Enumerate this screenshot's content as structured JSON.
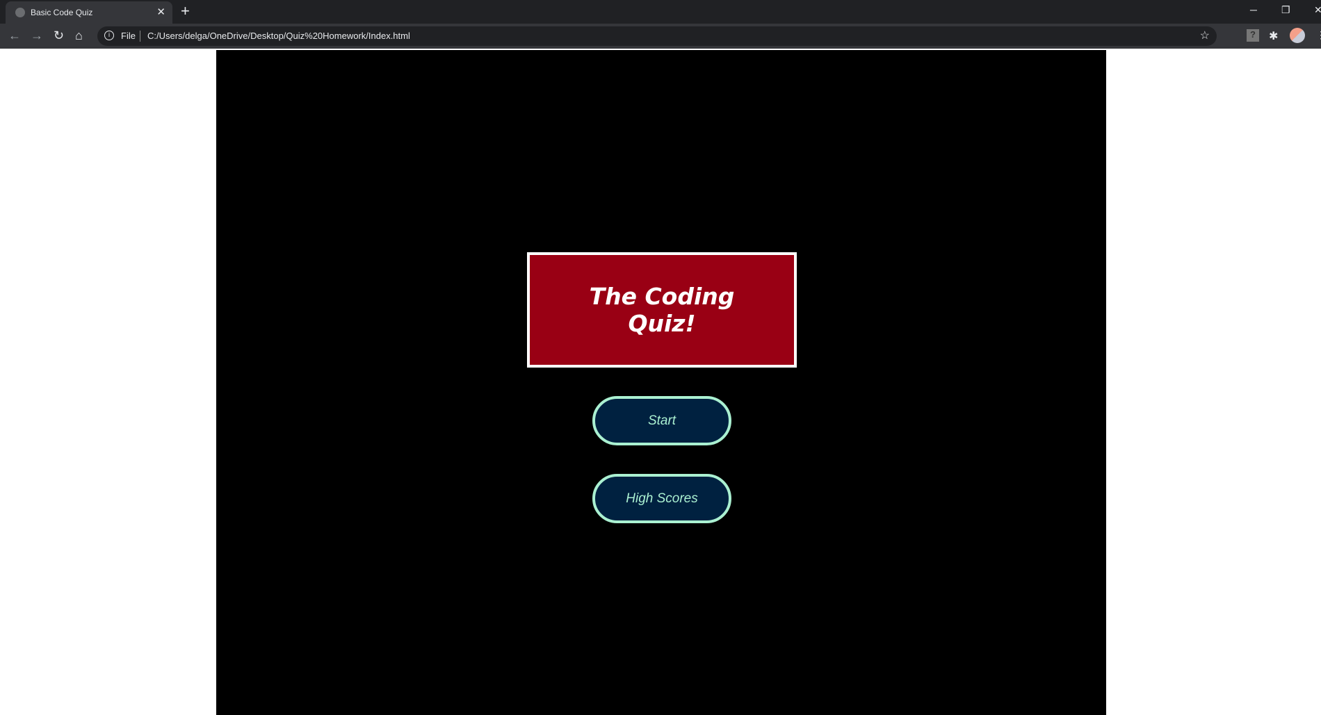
{
  "browser": {
    "tab_title": "Basic Code Quiz",
    "new_tab": "+",
    "scheme_label": "File",
    "url": "C:/Users/delga/OneDrive/Desktop/Quiz%20Homework/Index.html"
  },
  "page": {
    "title": "The Coding Quiz!",
    "start_label": "Start",
    "highscores_label": "High Scores"
  },
  "colors": {
    "title_bg": "#990014",
    "button_bg": "#002140",
    "button_accent": "#aaf0d1"
  }
}
